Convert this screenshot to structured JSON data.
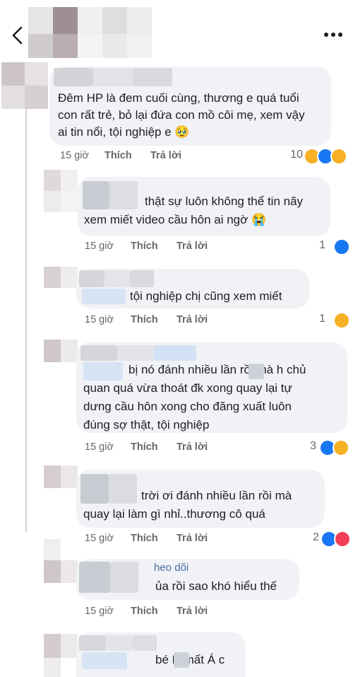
{
  "comments": [
    {
      "lines": [
        "Đêm HP là đem cuối cùng, thương e quá tuổi",
        "con rất trẻ, bỏ lại đứa con mồ côi mẹ, xem vậy",
        "ai tin nổi, tội nghiệp e 🥹"
      ],
      "time": "15 giờ",
      "like": "Thích",
      "reply": "Trả lời",
      "reaction_count": "10"
    },
    {
      "lines": [
        "thật sự luôn không thể tin nãy",
        "xem miết video cầu hôn ai ngờ 😭"
      ],
      "time": "15 giờ",
      "like": "Thích",
      "reply": "Trả lời",
      "reaction_count": "1"
    },
    {
      "lines": [
        "tội nghiệp chị cũng xem miết"
      ],
      "time": "15 giờ",
      "like": "Thích",
      "reply": "Trả lời",
      "reaction_count": "1"
    },
    {
      "lines": [
        "bị nó đánh nhiều lần rồi mà h   chủ",
        "quan quá vừa thoát đk xong quay lại tự",
        "dưng cầu hôn xong cho đăng xuất luôn",
        "đúng sợ thật, tội nghiệp"
      ],
      "time": "15 giờ",
      "like": "Thích",
      "reply": "Trả lời",
      "reaction_count": "3"
    },
    {
      "lines": [
        "trời ơi đánh nhiều lần rồi mà",
        "quay lại làm gì nhỉ..thương cô quá"
      ],
      "time": "15 giờ",
      "like": "Thích",
      "reply": "Trả lời",
      "reaction_count": "2"
    },
    {
      "follow": "heo dõi",
      "lines": [
        "ủa rồi sao khó hiểu thế"
      ],
      "time": "15 giờ",
      "like": "Thích",
      "reply": "Trả lời"
    },
    {
      "lines": [
        "bé H   mất Á c"
      ]
    }
  ],
  "colors": {
    "like_blue": "#1877f2",
    "haha_yellow": "#f7b125",
    "meta_gray": "#65676b",
    "bubble_bg": "#f0f2f5"
  },
  "icons": {
    "back": "chevron-left-icon",
    "more": "more-horizontal-icon"
  }
}
